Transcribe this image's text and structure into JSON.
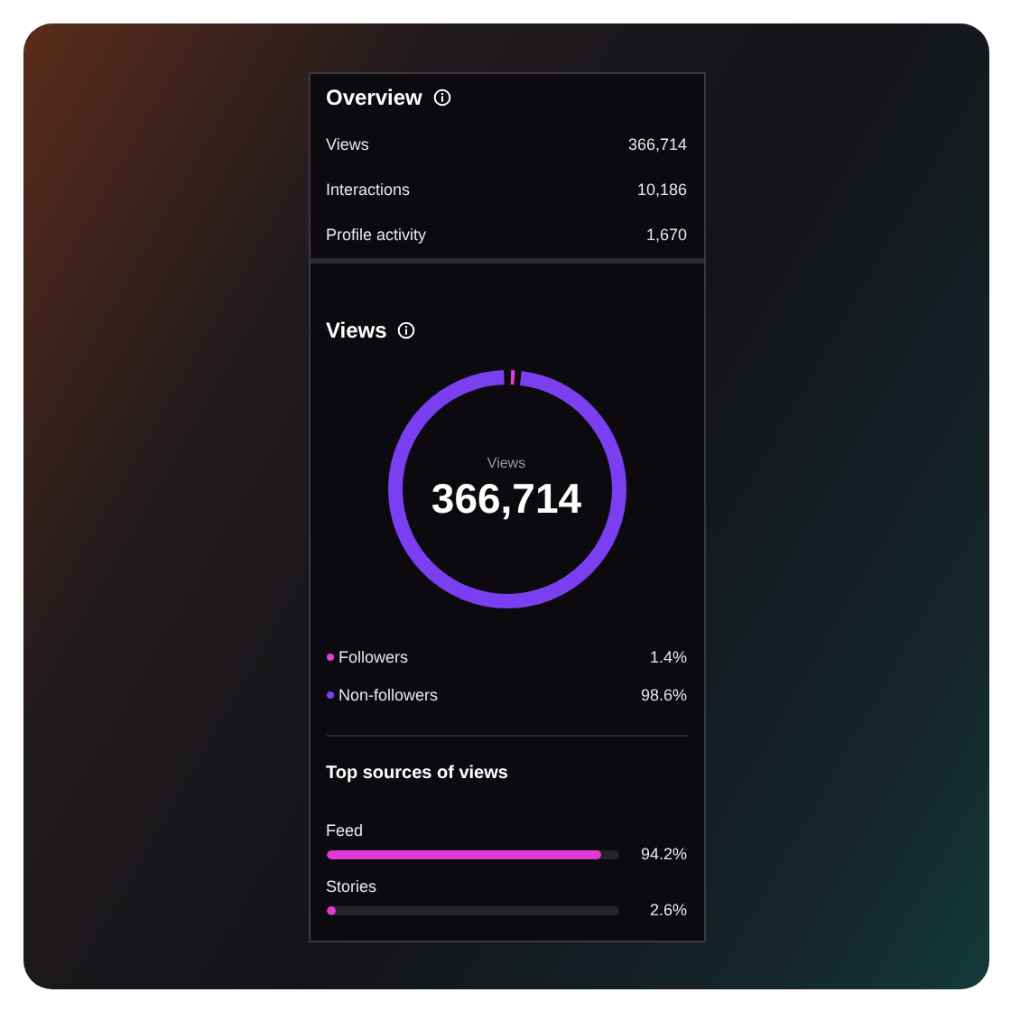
{
  "overview": {
    "title": "Overview",
    "rows": [
      {
        "label": "Views",
        "value": "366,714"
      },
      {
        "label": "Interactions",
        "value": "10,186"
      },
      {
        "label": "Profile activity",
        "value": "1,670"
      }
    ]
  },
  "views": {
    "title": "Views",
    "center_label": "Views",
    "center_value": "366,714",
    "legend": [
      {
        "label": "Followers",
        "value": "1.4%",
        "color": "#e040d8"
      },
      {
        "label": "Non-followers",
        "value": "98.6%",
        "color": "#7b3ff2"
      }
    ]
  },
  "top_sources": {
    "title": "Top sources of views",
    "items": [
      {
        "label": "Feed",
        "level": 0.942,
        "value": "94.2%"
      },
      {
        "label": "Stories",
        "level": 0.026,
        "value": "2.6%"
      }
    ]
  }
}
